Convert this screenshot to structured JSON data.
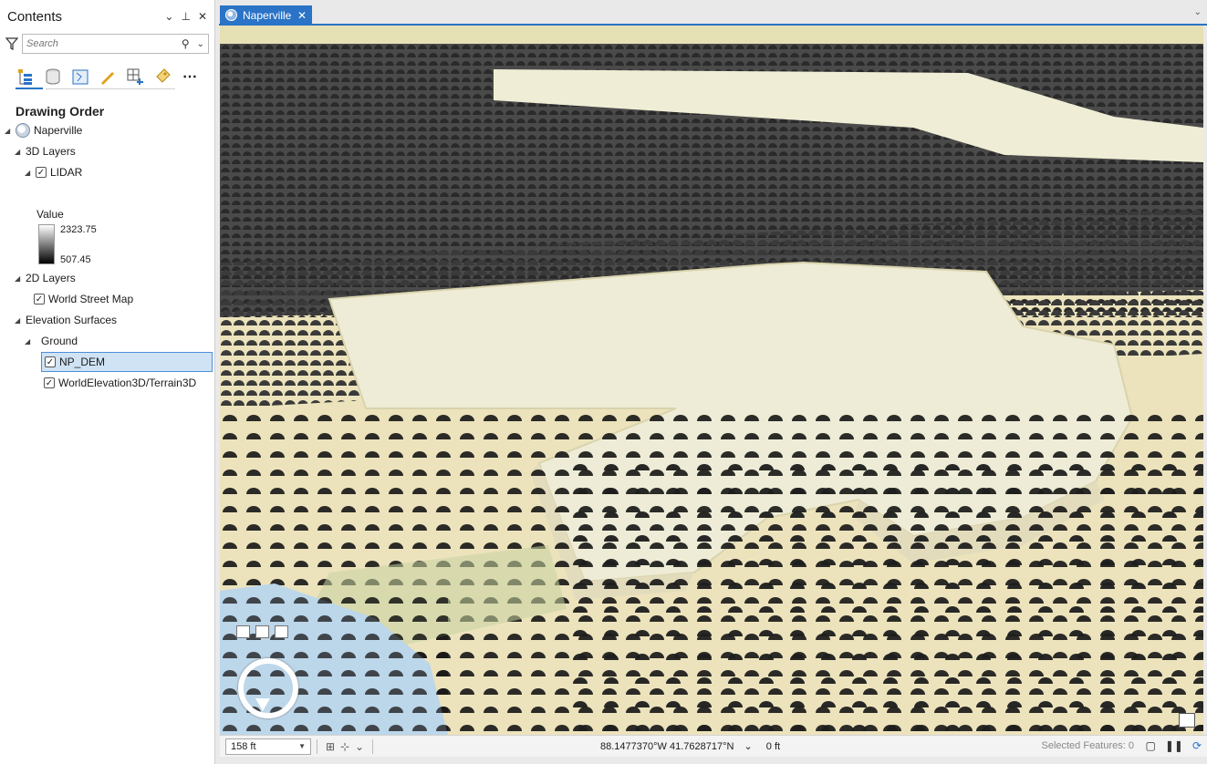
{
  "contents": {
    "title": "Contents",
    "search_placeholder": "Search",
    "section_title": "Drawing Order",
    "tree": {
      "map_name": "Naperville",
      "group_3d": "3D Layers",
      "lidar": "LIDAR",
      "legend_title": "Value",
      "legend_max": "2323.75",
      "legend_min": "507.45",
      "group_2d": "2D Layers",
      "street_map": "World Street Map",
      "group_elev": "Elevation Surfaces",
      "ground": "Ground",
      "np_dem": "NP_DEM",
      "terrain": "WorldElevation3D/Terrain3D"
    }
  },
  "map_tab": {
    "label": "Naperville"
  },
  "statusbar": {
    "scale": "158 ft",
    "coordinates": "88.1477370°W 41.7628717°N",
    "elevation": "0 ft",
    "selected_features": "Selected Features: 0"
  },
  "colors": {
    "accent": "#2a73c6",
    "selection": "#cfe3f5",
    "water": "#bcd6ea"
  }
}
